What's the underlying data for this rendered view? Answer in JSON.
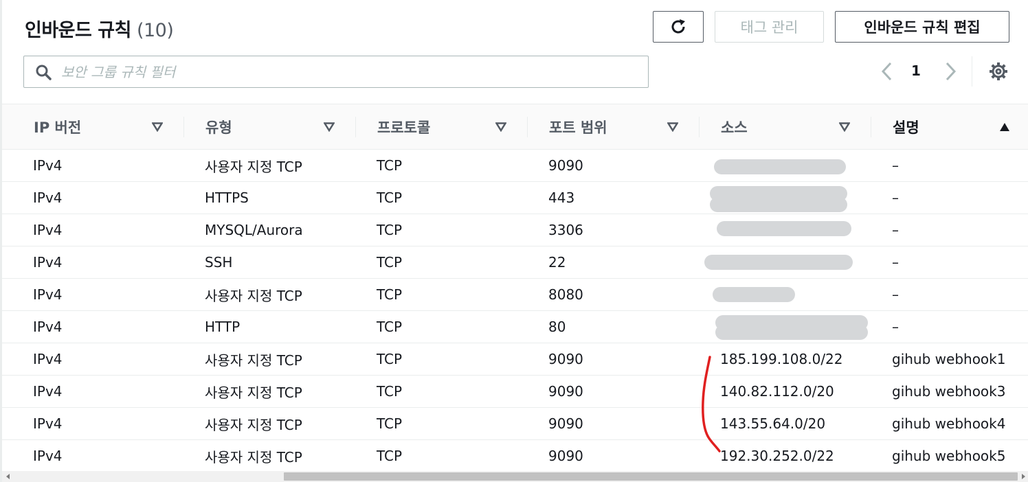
{
  "header": {
    "title": "인바운드 규칙",
    "count": "(10)",
    "refresh_icon": "refresh-icon",
    "manage_tags_label": "태그 관리",
    "edit_rules_label": "인바운드 규칙 편집"
  },
  "search": {
    "placeholder": "보안 그룹 규칙 필터",
    "value": "",
    "icon": "search-icon"
  },
  "pagination": {
    "current_page": "1",
    "prev_icon": "chevron-left-icon",
    "next_icon": "chevron-right-icon",
    "settings_icon": "gear-icon"
  },
  "table": {
    "columns": [
      {
        "label": "IP 버전",
        "sort": "none"
      },
      {
        "label": "유형",
        "sort": "none"
      },
      {
        "label": "프로토콜",
        "sort": "none"
      },
      {
        "label": "포트 범위",
        "sort": "none"
      },
      {
        "label": "소스",
        "sort": "none"
      },
      {
        "label": "설명",
        "sort": "ascending"
      }
    ],
    "rows": [
      {
        "ip_version": "IPv4",
        "type": "사용자 지정 TCP",
        "protocol": "TCP",
        "port": "9090",
        "source": "",
        "description": "–"
      },
      {
        "ip_version": "IPv4",
        "type": "HTTPS",
        "protocol": "TCP",
        "port": "443",
        "source": "",
        "description": "–"
      },
      {
        "ip_version": "IPv4",
        "type": "MYSQL/Aurora",
        "protocol": "TCP",
        "port": "3306",
        "source": "",
        "description": "–"
      },
      {
        "ip_version": "IPv4",
        "type": "SSH",
        "protocol": "TCP",
        "port": "22",
        "source": "",
        "description": "–"
      },
      {
        "ip_version": "IPv4",
        "type": "사용자 지정 TCP",
        "protocol": "TCP",
        "port": "8080",
        "source": "",
        "description": "–"
      },
      {
        "ip_version": "IPv4",
        "type": "HTTP",
        "protocol": "TCP",
        "port": "80",
        "source": "",
        "description": "–"
      },
      {
        "ip_version": "IPv4",
        "type": "사용자 지정 TCP",
        "protocol": "TCP",
        "port": "9090",
        "source": "185.199.108.0/22",
        "description": "gihub webhook1"
      },
      {
        "ip_version": "IPv4",
        "type": "사용자 지정 TCP",
        "protocol": "TCP",
        "port": "9090",
        "source": "140.82.112.0/20",
        "description": "gihub webhook3"
      },
      {
        "ip_version": "IPv4",
        "type": "사용자 지정 TCP",
        "protocol": "TCP",
        "port": "9090",
        "source": "143.55.64.0/20",
        "description": "gihub webhook4"
      },
      {
        "ip_version": "IPv4",
        "type": "사용자 지정 TCP",
        "protocol": "TCP",
        "port": "9090",
        "source": "192.30.252.0/22",
        "description": "gihub webhook5"
      }
    ]
  },
  "colors": {
    "text": "#16191f",
    "muted": "#545b64",
    "border": "#eaeded",
    "redaction": "#d5d7d9",
    "annotation": "#e02020"
  }
}
